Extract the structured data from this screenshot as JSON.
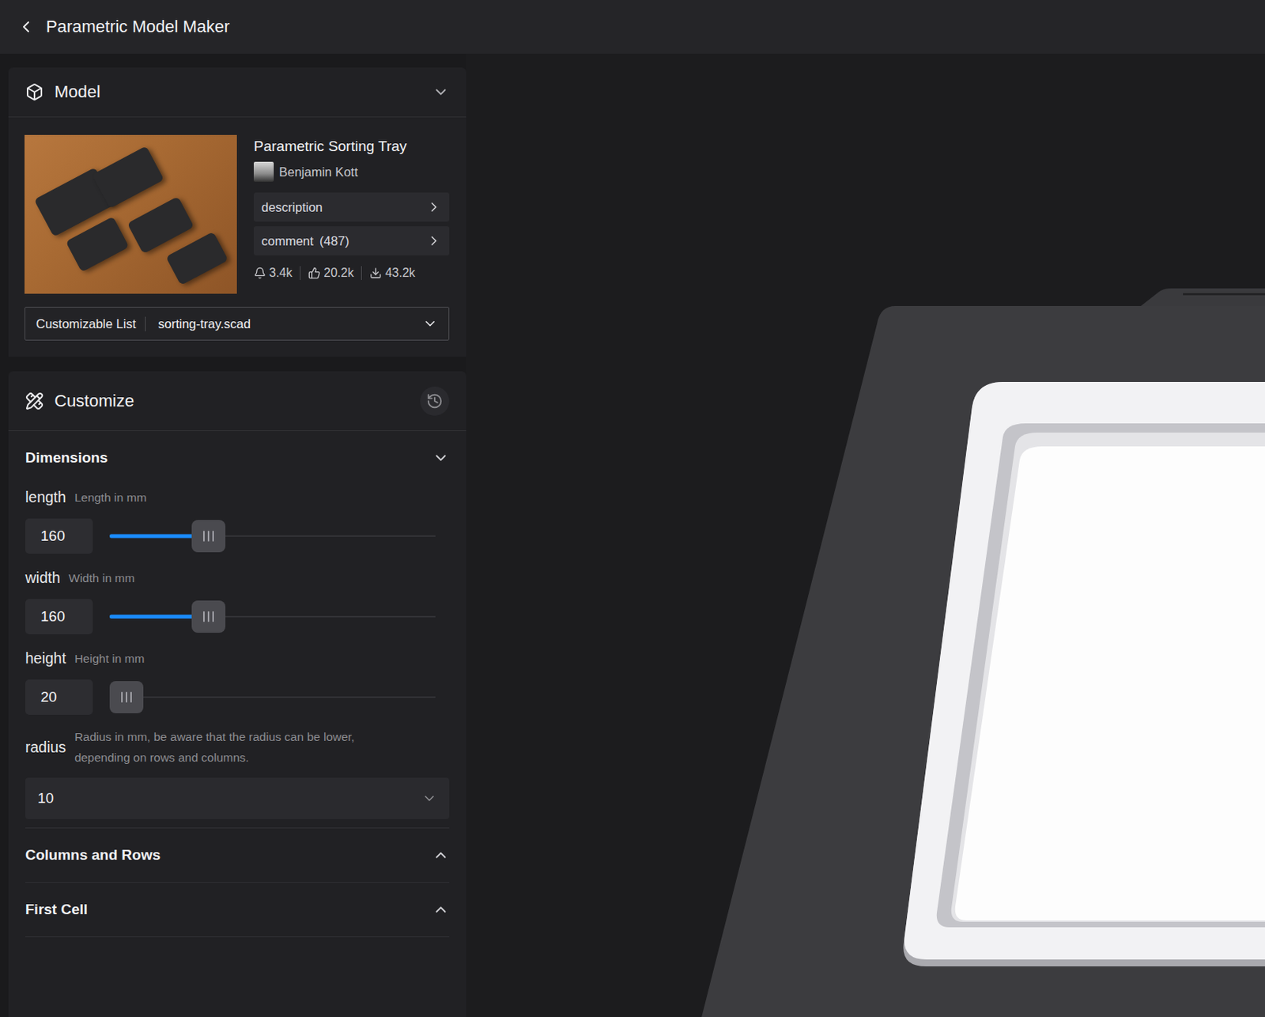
{
  "header": {
    "title": "Parametric Model Maker"
  },
  "model_panel": {
    "title": "Model",
    "expanded": true,
    "model": {
      "name": "Parametric Sorting Tray",
      "author": "Benjamin Kott",
      "links": [
        {
          "label": "description"
        },
        {
          "label": "comment",
          "count": "(487)"
        }
      ],
      "stats": [
        {
          "kind": "boosts",
          "value": "3.4k"
        },
        {
          "kind": "likes",
          "value": "20.2k"
        },
        {
          "kind": "downloads",
          "value": "43.2k"
        }
      ]
    },
    "customizable_list": {
      "label": "Customizable List",
      "value": "sorting-tray.scad"
    }
  },
  "customize_panel": {
    "title": "Customize",
    "groups": [
      {
        "title": "Dimensions",
        "expanded": true,
        "params": [
          {
            "kind": "slider",
            "name": "length",
            "hint": "Length in mm",
            "value": "160",
            "level": 0.28
          },
          {
            "kind": "slider",
            "name": "width",
            "hint": "Width in mm",
            "value": "160",
            "level": 0.28
          },
          {
            "kind": "slider",
            "name": "height",
            "hint": "Height in mm",
            "value": "20",
            "level": 0
          },
          {
            "kind": "select",
            "name": "radius",
            "hint": "Radius in mm, be aware that the radius can be lower, depending on rows and columns.",
            "value": "10"
          }
        ]
      },
      {
        "title": "Columns and Rows",
        "expanded": false,
        "params": []
      },
      {
        "title": "First Cell",
        "expanded": false,
        "params": []
      }
    ]
  }
}
